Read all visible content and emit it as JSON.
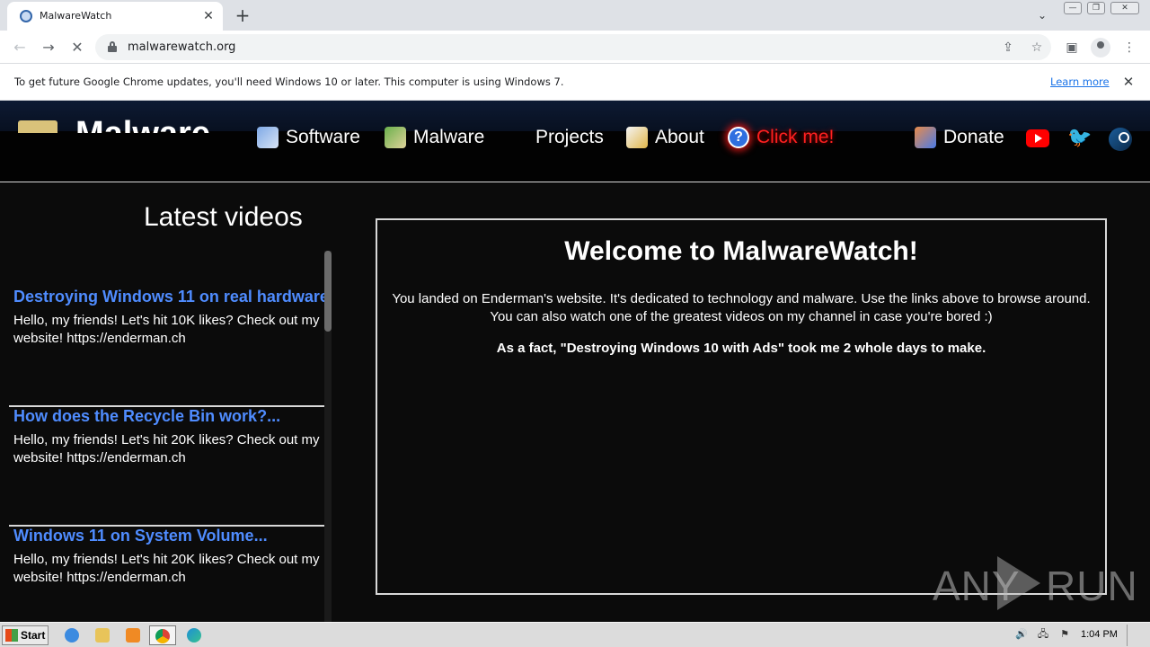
{
  "browser": {
    "tab": {
      "title": "MalwareWatch",
      "close": "✕"
    },
    "new_tab": "+",
    "tab_search": "⌄",
    "window": {
      "minimize": "—",
      "restore": "❐",
      "close": "✕"
    },
    "nav": {
      "back": "←",
      "forward": "→",
      "reload": "✕"
    },
    "address": "malwarewatch.org",
    "omnibox_icons": {
      "share": "⇪",
      "bookmark": "☆"
    },
    "toolbar_icons": {
      "sidepanel": "▣",
      "menu": "⋮"
    }
  },
  "infobar": {
    "message": "To get future Google Chrome updates, you'll need Windows 10 or later. This computer is using Windows 7.",
    "link": "Learn more",
    "close": "✕"
  },
  "site": {
    "logo_text": "Malware",
    "nav": [
      {
        "label": "Software",
        "icon": "software-icon"
      },
      {
        "label": "Malware",
        "icon": "malware-icon"
      },
      {
        "label": "Projects",
        "icon": ""
      },
      {
        "label": "About",
        "icon": "about-icon"
      },
      {
        "label": "Click me!",
        "icon": "help-icon",
        "color": "#ff2020"
      },
      {
        "label": "Donate",
        "icon": "donate-icon"
      }
    ],
    "help_glyph": "?",
    "twitter_glyph": "🐦",
    "social": [
      "youtube",
      "twitter",
      "steam"
    ],
    "sidebar": {
      "heading": "Latest videos",
      "videos": [
        {
          "title": "Destroying Windows 11 on real hardware",
          "desc": "Hello, my friends! Let's hit 10K likes? Check out my website! https://enderman.ch"
        },
        {
          "title": "How does the Recycle Bin work?...",
          "desc": "Hello, my friends! Let's hit 20K likes? Check out my website! https://enderman.ch"
        },
        {
          "title": "Windows 11 on System Volume...",
          "desc": "Hello, my friends! Let's hit 20K likes? Check out my website! https://enderman.ch"
        }
      ]
    },
    "welcome": {
      "title": "Welcome to MalwareWatch!",
      "body_line1": "You landed on Enderman's website. It's dedicated to technology and malware. Use the links above to browse around.",
      "body_line2": "You can also watch one of the greatest videos on my channel in case you're bored :)",
      "fact": "As a fact, \"Destroying Windows 10 with Ads\" took me 2 whole days to make."
    },
    "colors": {
      "link_blue": "#4f8cff",
      "accent_red": "#ff2020",
      "background": "#0b0b0b"
    }
  },
  "watermark": {
    "left": "ANY",
    "right": "RUN"
  },
  "taskbar": {
    "start_label": "Start",
    "apps": [
      "internet-explorer",
      "file-explorer",
      "media-player",
      "chrome",
      "edge"
    ],
    "tray_icons": {
      "volume": "🔊",
      "network": "🖧",
      "flag": "⚑"
    },
    "clock": "1:04 PM"
  }
}
